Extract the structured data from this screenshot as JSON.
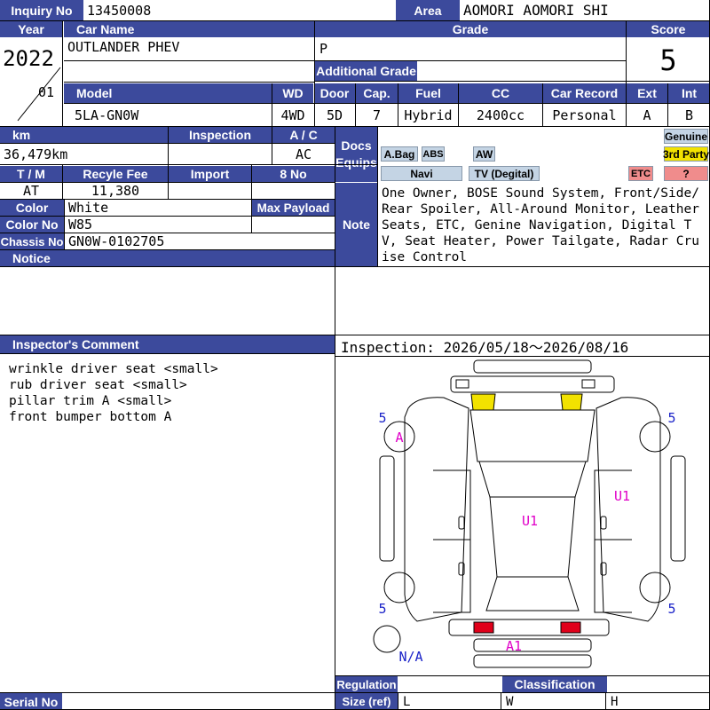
{
  "header": {
    "inquiry_label": "Inquiry No",
    "inquiry_value": "13450008",
    "area_label": "Area",
    "area_value": "AOMORI AOMORI SHI"
  },
  "vehicle": {
    "year_label": "Year",
    "year_value": "2022",
    "month_value": "01",
    "car_name_label": "Car Name",
    "car_name_value": "OUTLANDER PHEV",
    "grade_label": "Grade",
    "grade_value": "P",
    "additional_grade_label": "Additional Grade",
    "additional_grade_value": "",
    "score_label": "Score",
    "score_value": "5"
  },
  "specs": {
    "model_label": "Model",
    "model_value": "5LA-GN0W",
    "wd_label": "WD",
    "wd_value": "4WD",
    "door_label": "Door",
    "door_value": "5D",
    "cap_label": "Cap.",
    "cap_value": "7",
    "fuel_label": "Fuel",
    "fuel_value": "Hybrid",
    "cc_label": "CC",
    "cc_value": "2400cc",
    "car_record_label": "Car Record",
    "car_record_value": "Personal",
    "ext_label": "Ext",
    "ext_value": "A",
    "int_label": "Int",
    "int_value": "B"
  },
  "details": {
    "km_label": "km",
    "km_value": "36,479km",
    "inspection_label": "Inspection",
    "inspection_value": "",
    "ac_label": "A / C",
    "ac_value": "AC",
    "tm_label": "T / M",
    "tm_value": "AT",
    "recycle_label": "Recyle Fee",
    "recycle_value": "11,380",
    "import_label": "Import",
    "import_value": "",
    "eightno_label": "8 No",
    "eightno_value": "",
    "color_label": "Color",
    "color_value": "White",
    "max_payload_label": "Max Payload",
    "color_no_label": "Color No",
    "color_no_value": "W85",
    "chassis_label": "Chassis No",
    "chassis_value": "GN0W-0102705",
    "notice_label": "Notice"
  },
  "docs": {
    "label_line1": "Docs",
    "label_line2": "Equips",
    "badges": {
      "abag": "A.Bag",
      "abs": "ABS",
      "aw": "AW",
      "genuine": "Genuine",
      "third_party": "3rd Party",
      "navi": "Navi",
      "tv": "TV (Degital)",
      "etc": "ETC",
      "question": "?"
    }
  },
  "note": {
    "label": "Note",
    "text": "One Owner, BOSE Sound System, Front/Side/Rear Spoiler, All-Around Monitor, Leather Seats, ETC, Genine Navigation, Digital TV, Seat Heater, Power Tailgate, Radar Cruise Control"
  },
  "inspector": {
    "label": "Inspector's Comment",
    "lines": [
      "wrinkle driver seat <small>",
      "rub driver seat <small>",
      "pillar trim A <small>",
      "front bumper bottom A"
    ]
  },
  "inspection_period": "Inspection: 2026/05/18～2026/08/16",
  "diagram": {
    "tire_marks": [
      "5",
      "5",
      "5",
      "5"
    ],
    "marks": {
      "front_left_wheel": "A",
      "rear_right_panel": "U1",
      "roof": "U1",
      "front_bumper": "A1",
      "spare": "N/A"
    },
    "colors": {
      "yellow": "#f2e200",
      "red": "#e0001a",
      "marker": "#e000c8",
      "tire_num": "#1a22c8"
    }
  },
  "footer": {
    "serial_label": "Serial No",
    "regulation_label": "Regulation",
    "classification_label": "Classification",
    "size_label": "Size (ref)",
    "size_l": "L",
    "size_w": "W",
    "size_h": "H"
  },
  "colors": {
    "header_bg": "#3c4a9c",
    "badge_blue": "#c4d4e4",
    "badge_yellow": "#f2e200",
    "badge_red": "#f08c8c"
  }
}
